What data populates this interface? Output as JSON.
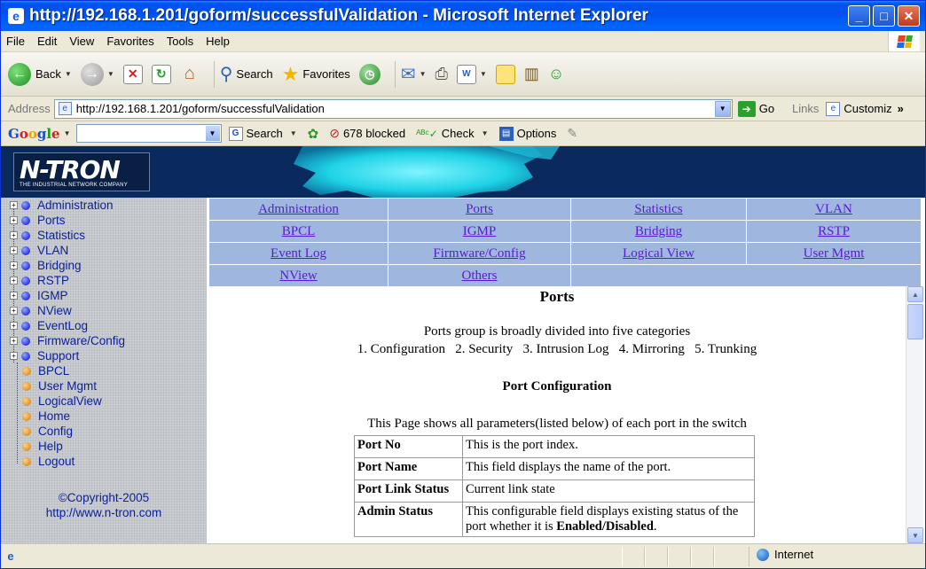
{
  "window": {
    "title": "http://192.168.1.201/goform/successfulValidation - Microsoft Internet Explorer"
  },
  "menu": [
    "File",
    "Edit",
    "View",
    "Favorites",
    "Tools",
    "Help"
  ],
  "toolbar": {
    "back": "Back",
    "search": "Search",
    "favorites": "Favorites"
  },
  "address": {
    "label": "Address",
    "url": "http://192.168.1.201/goform/successfulValidation",
    "go": "Go",
    "links": "Links",
    "customize": "Customiz",
    "more": "»"
  },
  "google": {
    "logo": "Google",
    "search": "Search",
    "blocked": "678 blocked",
    "check": "Check",
    "options": "Options"
  },
  "banner": {
    "logo": "N-TRON",
    "tagline": "THE INDUSTRIAL NETWORK COMPANY"
  },
  "sidebar": {
    "items": [
      {
        "label": "Administration",
        "expandable": true
      },
      {
        "label": "Ports",
        "expandable": true
      },
      {
        "label": "Statistics",
        "expandable": true
      },
      {
        "label": "VLAN",
        "expandable": true
      },
      {
        "label": "Bridging",
        "expandable": true
      },
      {
        "label": "RSTP",
        "expandable": true
      },
      {
        "label": "IGMP",
        "expandable": true
      },
      {
        "label": "NView",
        "expandable": true
      },
      {
        "label": "EventLog",
        "expandable": true
      },
      {
        "label": "Firmware/Config",
        "expandable": true
      },
      {
        "label": "Support",
        "expandable": true
      },
      {
        "label": "BPCL",
        "expandable": false
      },
      {
        "label": "User Mgmt",
        "expandable": false
      },
      {
        "label": "LogicalView",
        "expandable": false
      },
      {
        "label": "Home",
        "expandable": false
      },
      {
        "label": "Config",
        "expandable": false
      },
      {
        "label": "Help",
        "expandable": false
      },
      {
        "label": "Logout",
        "expandable": false
      }
    ],
    "copyright": "©Copyright-2005",
    "site": "http://www.n-tron.com"
  },
  "nav": {
    "rows": [
      [
        "Administration",
        "Ports",
        "Statistics",
        "VLAN"
      ],
      [
        "BPCL",
        "IGMP",
        "Bridging",
        "RSTP"
      ],
      [
        "Event Log",
        "Firmware/Config",
        "Logical View",
        "User Mgmt"
      ],
      [
        "NView",
        "Others",
        "",
        ""
      ]
    ]
  },
  "main": {
    "heading": "Ports",
    "intro": "Ports group is broadly divided into five categories",
    "categories": "1. Configuration   2. Security   3. Intrusion Log   4. Mirroring   5. Trunking",
    "subheading": "Port Configuration",
    "desc": "This Page shows all parameters(listed below) of each port in the switch",
    "table": [
      {
        "key": "Port No",
        "value": "This is the port index."
      },
      {
        "key": "Port Name",
        "value": "This field displays the name of the port."
      },
      {
        "key": "Port Link Status",
        "value": "Current link state"
      },
      {
        "key": "Admin Status",
        "value": "This configurable field displays existing status of the port whether it is ",
        "bold": "Enabled/Disabled",
        "tail": "."
      }
    ]
  },
  "status": {
    "zone": "Internet"
  }
}
